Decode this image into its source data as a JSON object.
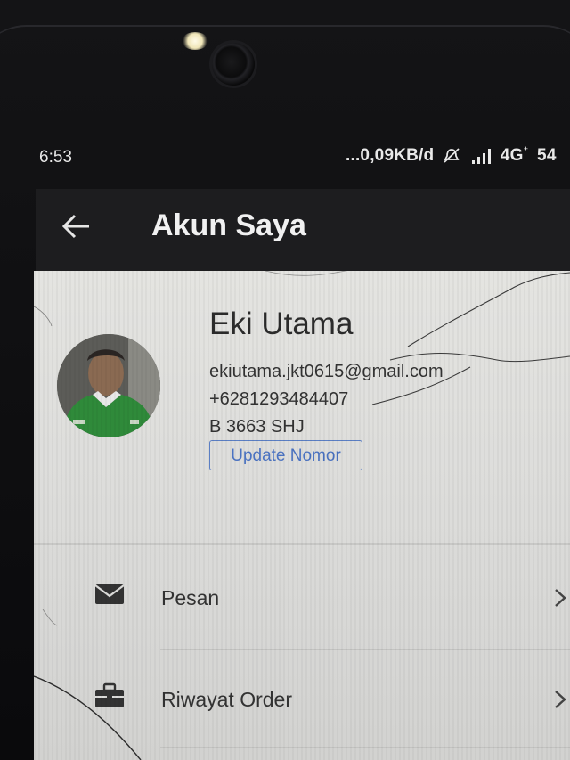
{
  "status_bar": {
    "time": "6:53",
    "network_speed": "...0,09KB/d",
    "network_type": "4G",
    "battery": "54"
  },
  "header": {
    "title": "Akun Saya",
    "back_icon": "arrow-left-icon"
  },
  "profile": {
    "name": "Eki Utama",
    "email": "ekiutama.jkt0615@gmail.com",
    "phone": "+6281293484407",
    "plate": "B 3663 SHJ",
    "update_button_label": "Update Nomor"
  },
  "menu": {
    "items": [
      {
        "label": "Pesan",
        "icon": "envelope-icon"
      },
      {
        "label": "Riwayat Order",
        "icon": "briefcase-icon"
      }
    ]
  },
  "colors": {
    "header_bg": "#1d1d1f",
    "sheet_bg": "#e0e0de",
    "accent_blue": "#4b73c2"
  }
}
